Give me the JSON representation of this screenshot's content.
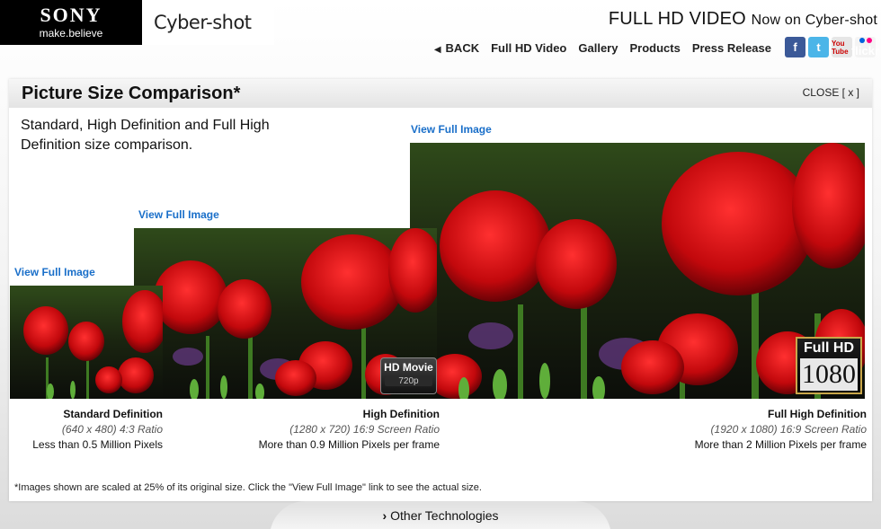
{
  "header": {
    "brand": "SONY",
    "tagline": "make.believe",
    "product_logo": "Cyber-shot",
    "headline_main": "FULL HD VIDEO",
    "headline_sub": "Now on Cyber-shot"
  },
  "nav": {
    "back": "BACK",
    "items": [
      "Full HD Video",
      "Gallery",
      "Products",
      "Press Release"
    ]
  },
  "social": [
    "facebook-icon",
    "twitter-icon",
    "youtube-icon",
    "flickr-icon"
  ],
  "social_text": {
    "facebook": "f",
    "twitter": "t",
    "youtube": "You Tube",
    "flickr": "flickr"
  },
  "panel": {
    "title": "Picture Size Comparison*",
    "close": "CLOSE [ x ]",
    "intro": "Standard, High Definition and Full High Definition size comparison.",
    "view_link": "View Full Image",
    "footnote": "*Images shown are scaled at 25% of its original size. Click the \"View Full Image\" link to see the actual size."
  },
  "comparisons": [
    {
      "title": "Standard Definition",
      "ratio": "(640 x 480) 4:3 Ratio",
      "pixels": "Less than 0.5 Million Pixels"
    },
    {
      "title": "High Definition",
      "ratio": "(1280 x 720) 16:9 Screen Ratio",
      "pixels": "More than 0.9 Million Pixels per frame"
    },
    {
      "title": "Full High Definition",
      "ratio": "(1920 x 1080) 16:9 Screen Ratio",
      "pixels": "More than 2 Million Pixels per frame"
    }
  ],
  "badges": {
    "hd_movie": "HD Movie",
    "hd_res": "720p",
    "full_hd": "Full HD",
    "full_res": "1080"
  },
  "bottom": {
    "other_tech": "Other Technologies"
  }
}
